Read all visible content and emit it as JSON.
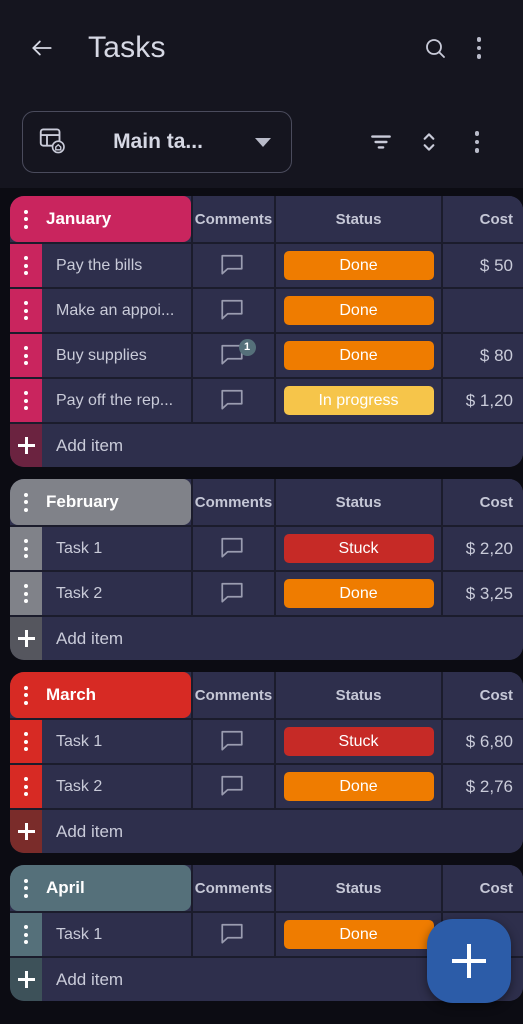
{
  "appbar": {
    "back_icon": "arrow-left-icon",
    "title": "Tasks",
    "search_icon": "search-icon",
    "menu_icon": "kebab-menu-icon"
  },
  "toolbar": {
    "board_icon": "board-home-icon",
    "board_name": "Main ta...",
    "caret_icon": "chevron-down-icon",
    "filter_icon": "filter-icon",
    "sort_icon": "sort-icon",
    "menu_icon": "kebab-menu-icon"
  },
  "columns": {
    "comments": "Comments",
    "status": "Status",
    "cost": "Cost"
  },
  "add_item_label": "Add item",
  "status_colors": {
    "done": "#ef7c00",
    "in_progress": "#f5c council",
    "stuck": "#c62a26"
  },
  "groups": [
    {
      "name": "January",
      "color": "#c9255e",
      "add_color": "#6b2340",
      "items": [
        {
          "name": "Pay the bills",
          "comments": "",
          "status": "Done",
          "status_color": "#ef7c00",
          "cost": "$ 50"
        },
        {
          "name": "Make an appoi...",
          "comments": "",
          "status": "Done",
          "status_color": "#ef7c00",
          "cost": ""
        },
        {
          "name": "Buy supplies",
          "comments": "1",
          "status": "Done",
          "status_color": "#ef7c00",
          "cost": "$ 80"
        },
        {
          "name": "Pay off the rep...",
          "comments": "",
          "status": "In progress",
          "status_color": "#f6c54a",
          "cost": "$ 1,20"
        }
      ]
    },
    {
      "name": "February",
      "color": "#808289",
      "add_color": "#55565e",
      "items": [
        {
          "name": "Task 1",
          "comments": "",
          "status": "Stuck",
          "status_color": "#c62a26",
          "cost": "$ 2,20"
        },
        {
          "name": "Task 2",
          "comments": "",
          "status": "Done",
          "status_color": "#ef7c00",
          "cost": "$ 3,25"
        }
      ]
    },
    {
      "name": "March",
      "color": "#d72a24",
      "add_color": "#7a2c2a",
      "items": [
        {
          "name": "Task 1",
          "comments": "",
          "status": "Stuck",
          "status_color": "#c62a26",
          "cost": "$ 6,80"
        },
        {
          "name": "Task 2",
          "comments": "",
          "status": "Done",
          "status_color": "#ef7c00",
          "cost": "$ 2,76"
        }
      ]
    },
    {
      "name": "April",
      "color": "#55707a",
      "add_color": "#3d5159",
      "items": [
        {
          "name": "Task 1",
          "comments": "",
          "status": "Done",
          "status_color": "#ef7c00",
          "cost": ""
        }
      ]
    }
  ],
  "fab": {
    "icon": "plus-icon"
  }
}
